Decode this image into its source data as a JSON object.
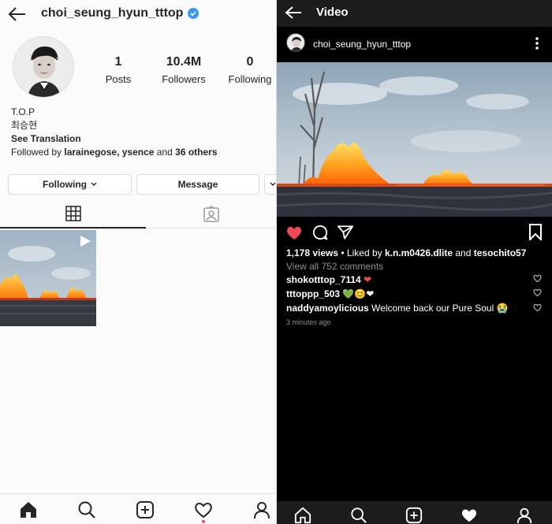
{
  "left": {
    "username": "choi_seung_hyun_tttop",
    "stats": [
      {
        "value": "1",
        "label": "Posts"
      },
      {
        "value": "10.4M",
        "label": "Followers"
      },
      {
        "value": "0",
        "label": "Following"
      }
    ],
    "bio": {
      "name": "T.O.P",
      "korean_name": "최승현",
      "translation_link": "See Translation",
      "followed_prefix": "Followed by ",
      "followed_users": "larainegose, ysence",
      "followed_and": " and ",
      "followed_others": "36 others"
    },
    "buttons": {
      "following": "Following",
      "message": "Message"
    },
    "icons": {
      "back": "back-arrow-icon",
      "verified": "verified-badge-icon",
      "grid": "grid-icon",
      "tagged": "tagged-photos-icon",
      "play": "video-play-icon"
    },
    "nav": [
      "home-icon",
      "search-icon",
      "new-post-icon",
      "activity-heart-icon",
      "profile-icon"
    ]
  },
  "right": {
    "header_title": "Video",
    "username": "choi_seung_hyun_tttop",
    "views": "1,178 views",
    "liked_by_prefix": " • Liked by ",
    "liked_user_1": "k.n.m0426.dlite",
    "liked_and": " and ",
    "liked_user_2": "tesochito57",
    "view_all": "View all 752 comments",
    "comments": [
      {
        "user": "shokotttop_7114",
        "text": "❤"
      },
      {
        "user": "tttoppp_503",
        "text": "💚😊❤"
      },
      {
        "user": "naddyamoylicious",
        "text": "Welcome back our Pure Soul 😭"
      }
    ],
    "time_ago": "3 minutes ago",
    "colors": {
      "like": "#ed4956",
      "verified": "#3897f0"
    }
  }
}
